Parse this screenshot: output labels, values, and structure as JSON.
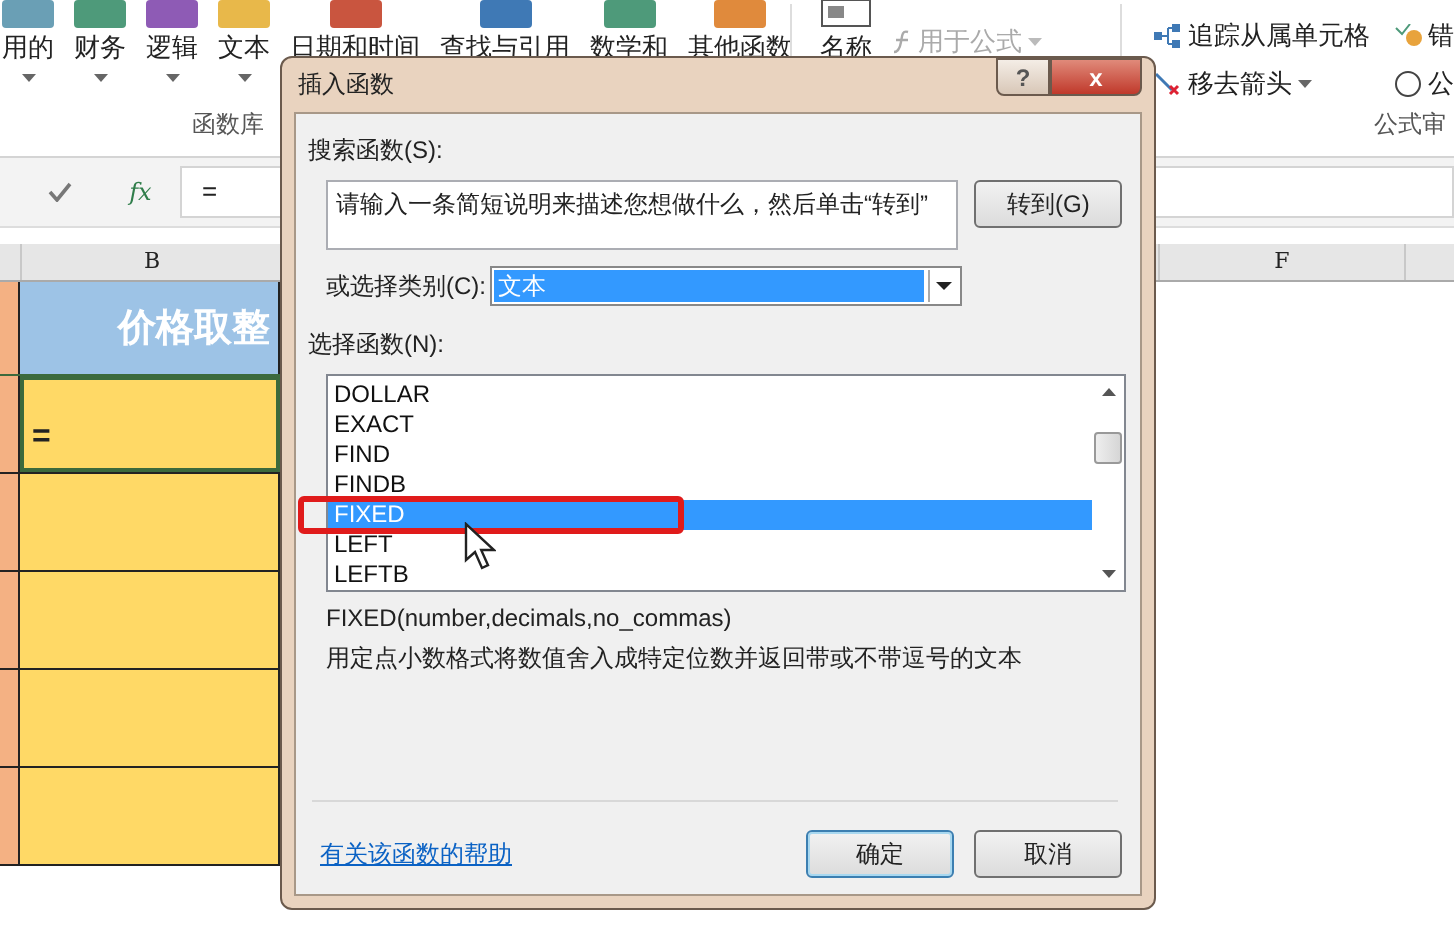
{
  "ribbon": {
    "function_buttons": [
      {
        "label": "用的",
        "color": "#6a9fb5"
      },
      {
        "label": "财务",
        "color": "#4e9a7a"
      },
      {
        "label": "逻辑",
        "color": "#8e5bb5"
      },
      {
        "label": "文本",
        "color": "#e8b84a"
      },
      {
        "label": "日期和时间",
        "color": "#c9553f"
      },
      {
        "label": "查找与引用",
        "color": "#3f79b5"
      },
      {
        "label": "数学和",
        "color": "#4e9a7a"
      },
      {
        "label": "其他函数",
        "color": "#e08a3c"
      }
    ],
    "group_label": "函数库",
    "names_button": "名称",
    "use_in_formula": "用于公式",
    "trace_dependents": "追踪从属单元格",
    "remove_arrows": "移去箭头",
    "error_check": "错",
    "evaluate": "公",
    "audit_group_label": "公式审"
  },
  "formula_bar": {
    "fx": "fx",
    "value": "="
  },
  "sheet": {
    "column_headers": [
      "B",
      "F"
    ],
    "header_cell": "价格取整",
    "active_cell": "="
  },
  "dialog": {
    "title": "插入函数",
    "help_button": "?",
    "close_button": "x",
    "search_label": "搜索函数(S):",
    "search_value": "请输入一条简短说明来描述您想做什么，然后单击“转到”",
    "go_button": "转到(G)",
    "category_label": "或选择类别(C):",
    "category_value": "文本",
    "functions_label": "选择函数(N):",
    "functions": [
      {
        "name": "DOLLAR",
        "selected": false
      },
      {
        "name": "EXACT",
        "selected": false
      },
      {
        "name": "FIND",
        "selected": false
      },
      {
        "name": "FINDB",
        "selected": false
      },
      {
        "name": "FIXED",
        "selected": true
      },
      {
        "name": "LEFT",
        "selected": false
      },
      {
        "name": "LEFTB",
        "selected": false
      }
    ],
    "signature": "FIXED(number,decimals,no_commas)",
    "description": "用定点小数格式将数值舍入成特定位数并返回带或不带逗号的文本",
    "help_link": "有关该函数的帮助",
    "ok_button": "确定",
    "cancel_button": "取消"
  }
}
